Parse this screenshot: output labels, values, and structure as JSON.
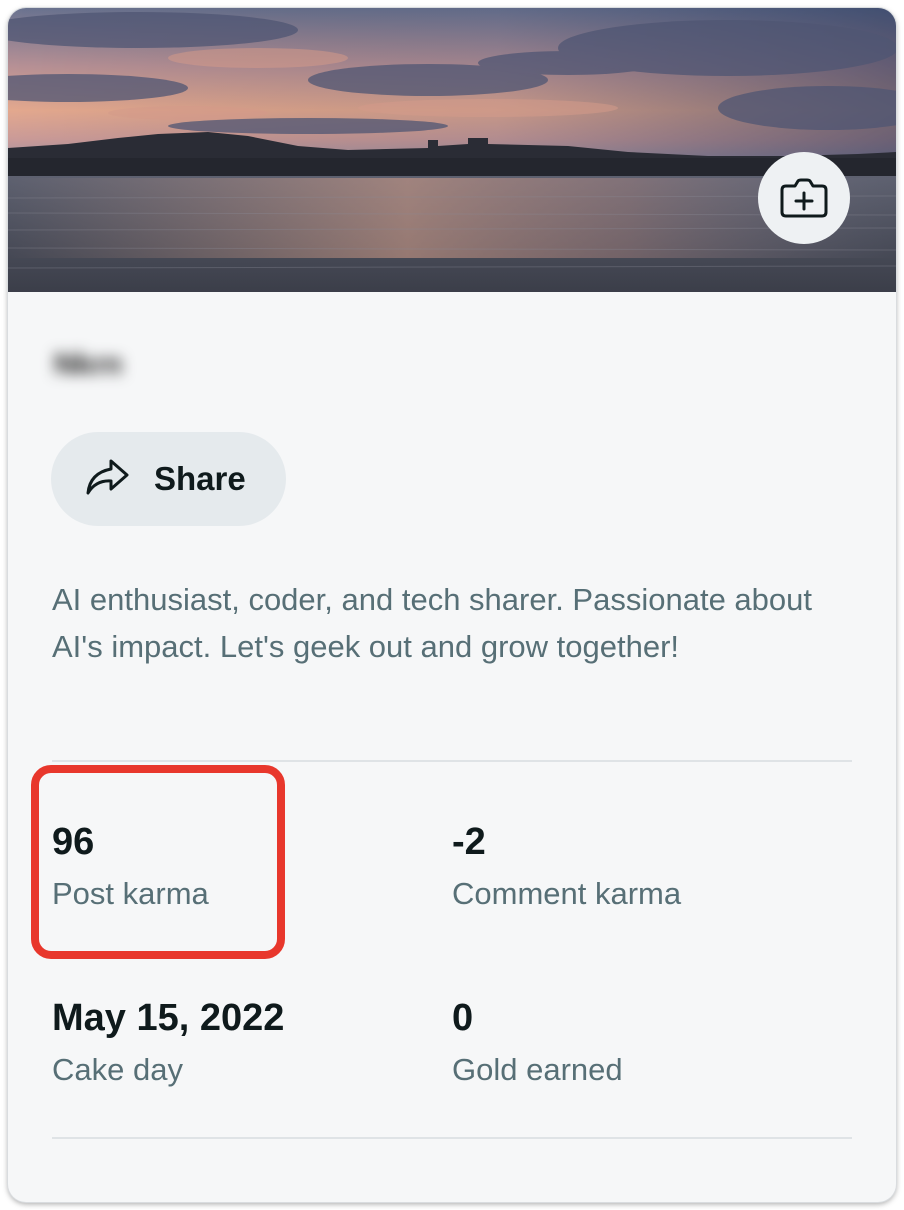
{
  "profile": {
    "username": "Nkrn",
    "share_label": "Share",
    "bio": "AI enthusiast, coder, and tech sharer. Passionate about AI's impact. Let's geek out and grow together!"
  },
  "stats": [
    {
      "value": "96",
      "label": "Post karma"
    },
    {
      "value": "-2",
      "label": "Comment karma"
    },
    {
      "value": "May 15, 2022",
      "label": "Cake day"
    },
    {
      "value": "0",
      "label": "Gold earned"
    }
  ],
  "icons": {
    "banner_camera": "camera-add-icon",
    "share": "share-arrow-icon"
  },
  "colors": {
    "card_background": "#f6f7f8",
    "share_button": "#e5eaed",
    "secondary_text": "#576f76",
    "highlight_box": "#e8372c"
  }
}
